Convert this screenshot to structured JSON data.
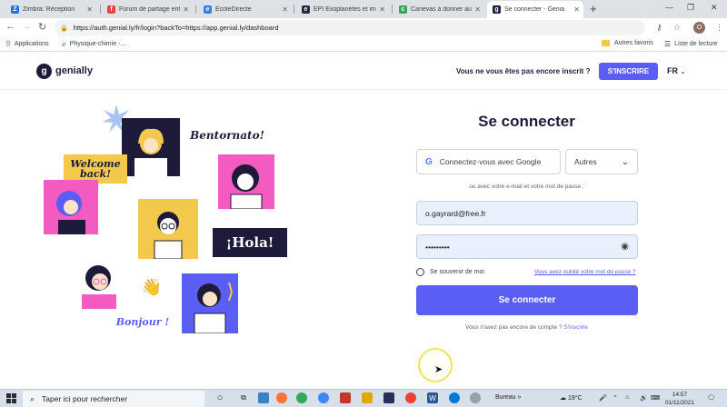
{
  "browser": {
    "tabs": [
      {
        "title": "Zimbra: Réception",
        "favicon_color": "#1a73e8",
        "favicon_letter": "Z",
        "active": false
      },
      {
        "title": "Forum de partage ent",
        "favicon_color": "#e8453c",
        "favicon_letter": "f",
        "active": false
      },
      {
        "title": "EcoleDirecte",
        "favicon_color": "#2f80ed",
        "favicon_letter": "e",
        "active": false
      },
      {
        "title": "EPI Exoplanètes et im",
        "favicon_color": "#1f2a44",
        "favicon_letter": "e",
        "active": false
      },
      {
        "title": "Canevas à donner aux",
        "favicon_color": "#34a853",
        "favicon_letter": "c",
        "active": false
      },
      {
        "title": "Se connecter - Genia",
        "favicon_color": "#1e1b3a",
        "favicon_letter": "g",
        "active": true
      }
    ],
    "url": "https://auth.genial.ly/fr/login?backTo=https://app.genial.ly/dashboard",
    "profile_initial": "O",
    "bookmarks": {
      "apps_label": "Applications",
      "item1": "Physique-chimie -...",
      "other_favorites": "Autres favoris",
      "reading_list": "Liste de lecture"
    }
  },
  "header": {
    "logo_text": "genially",
    "prompt": "Vous ne vous êtes pas encore inscrit ?",
    "signup_label": "S'INSCRIRE",
    "language": "FR"
  },
  "illustration": {
    "bubbles": {
      "bentornato": "Bentornato!",
      "welcome": "Welcome back!",
      "hola": "¡Hola!",
      "bonjour": "Bonjour !"
    }
  },
  "login": {
    "title": "Se connecter",
    "google_label": "Connectez-vous avec Google",
    "others_label": "Autres",
    "divider": "ou avec votre e-mail et votre mot de passe :",
    "email_value": "o.gayrard@free.fr",
    "password_value": "•••••••••",
    "remember_label": "Se souvenir de moi",
    "forgot_label": "Vous avez oublié votre mot de passe ?",
    "submit_label": "Se connecter",
    "no_account_text": "Vous n'avez pas encore de compte ?",
    "signup_link": "S'inscrire"
  },
  "taskbar": {
    "search_placeholder": "Taper ici pour rechercher",
    "bureau_label": "Bureau",
    "temperature": "19°C",
    "time": "14:57",
    "date": "01/11/2021"
  }
}
